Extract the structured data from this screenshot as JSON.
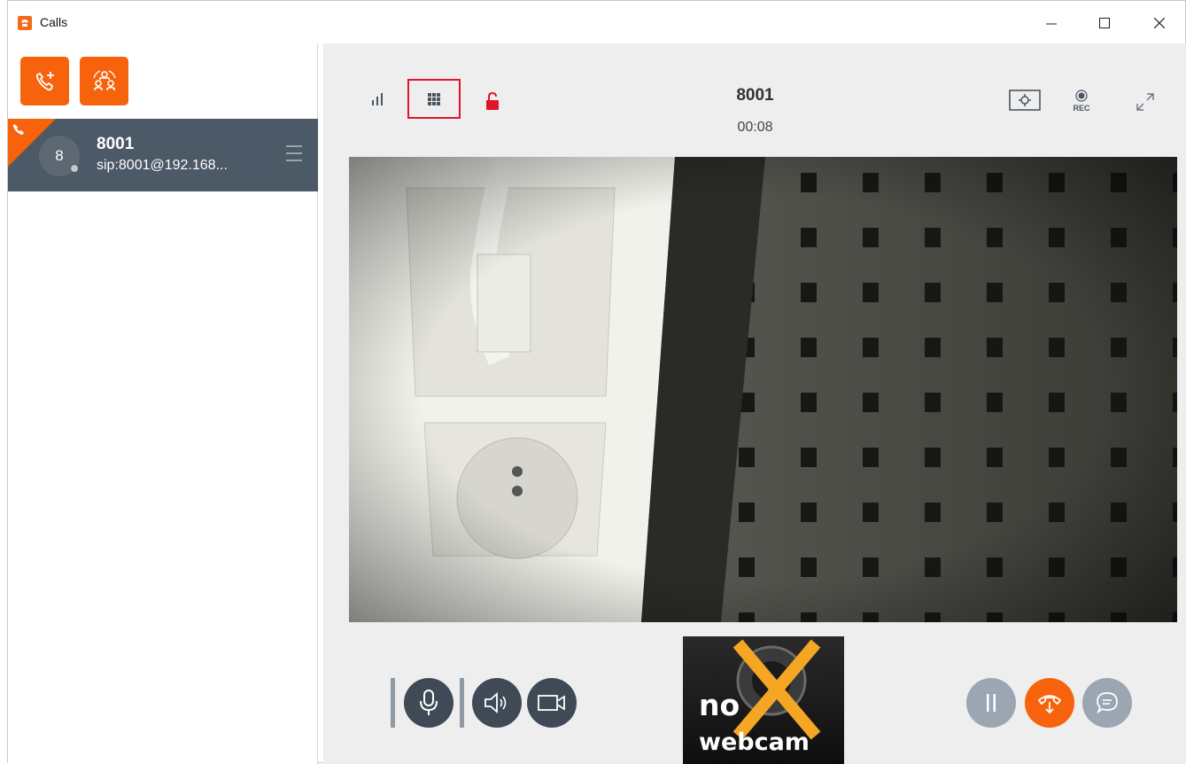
{
  "window": {
    "title": "Calls",
    "minimize_label": "—",
    "maximize_label": "☐",
    "close_label": "✕"
  },
  "sidebar": {
    "buttons": [
      {
        "icon": "new-call-icon"
      },
      {
        "icon": "conference-icon"
      }
    ],
    "calls": [
      {
        "avatar_letter": "8",
        "name": "8001",
        "uri": "sip:8001@192.168...",
        "status": "active-call"
      }
    ]
  },
  "call": {
    "peer": "8001",
    "duration": "00:08",
    "toolbar": {
      "left": [
        "signal-icon",
        "keypad-icon",
        "unlock-icon"
      ],
      "right": [
        "screen-share-icon",
        "record-icon",
        "fullscreen-icon"
      ],
      "rec_label": "REC"
    },
    "controls": {
      "left": [
        "microphone-icon",
        "speaker-icon",
        "camera-icon"
      ],
      "right": [
        "hold-icon",
        "transfer-icon",
        "chat-icon"
      ]
    },
    "local_preview": {
      "line1": "no",
      "line2": "webcam"
    }
  },
  "colors": {
    "accent": "#f7630c",
    "sidebar_selected": "#4c5966",
    "keypad_highlight": "#e0142a",
    "control_dark": "#3f4a56",
    "control_gray": "#9aa6b1"
  }
}
